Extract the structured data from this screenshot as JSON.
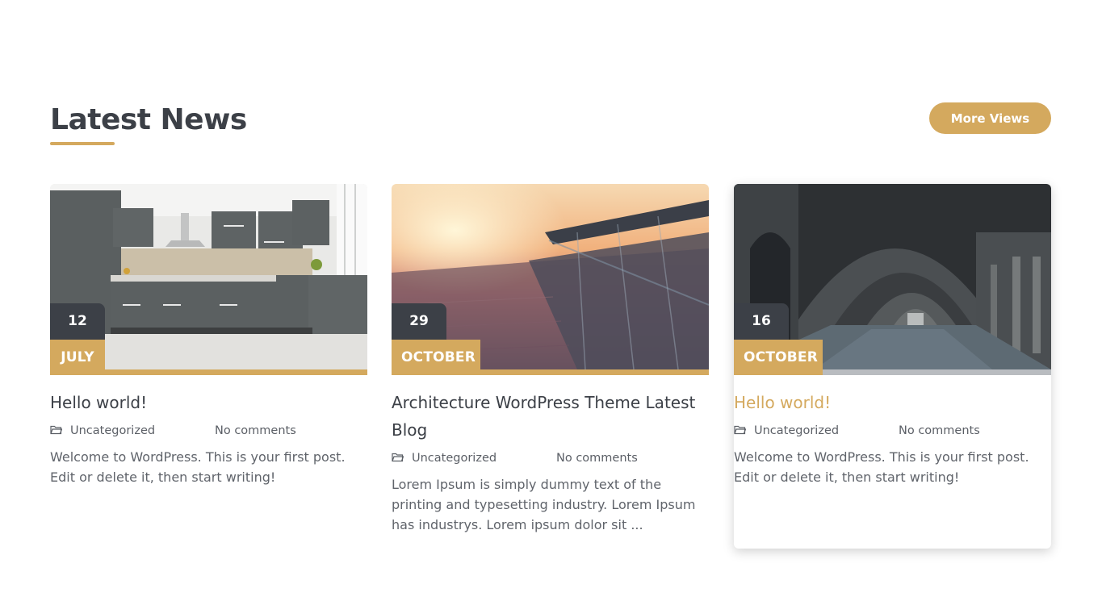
{
  "section": {
    "heading": "Latest News",
    "more_button": "More Views"
  },
  "colors": {
    "accent": "#d4a95e",
    "dark": "#3c4047",
    "text": "#60646b"
  },
  "posts": [
    {
      "day": "12",
      "month": "JULY",
      "title": "Hello world!",
      "category": "Uncategorized",
      "comments": "No comments",
      "excerpt": "Welcome to WordPress. This is your first post. Edit or delete it, then start writing!",
      "image": "kitchen-photo"
    },
    {
      "day": "29",
      "month": "OCTOBER",
      "title": "Architecture WordPress Theme Latest Blog",
      "category": "Uncategorized",
      "comments": "No comments",
      "excerpt": "Lorem Ipsum is simply dummy text of the printing and typesetting industry. Lorem Ipsum has industrys. Lorem ipsum dolor sit ...",
      "image": "sunset-bridge-photo"
    },
    {
      "day": "16",
      "month": "OCTOBER",
      "title": "Hello world!",
      "category": "Uncategorized",
      "comments": "No comments",
      "excerpt": "Welcome to WordPress. This is your first post. Edit or delete it, then start writing!",
      "image": "arched-corridor-photo"
    }
  ]
}
